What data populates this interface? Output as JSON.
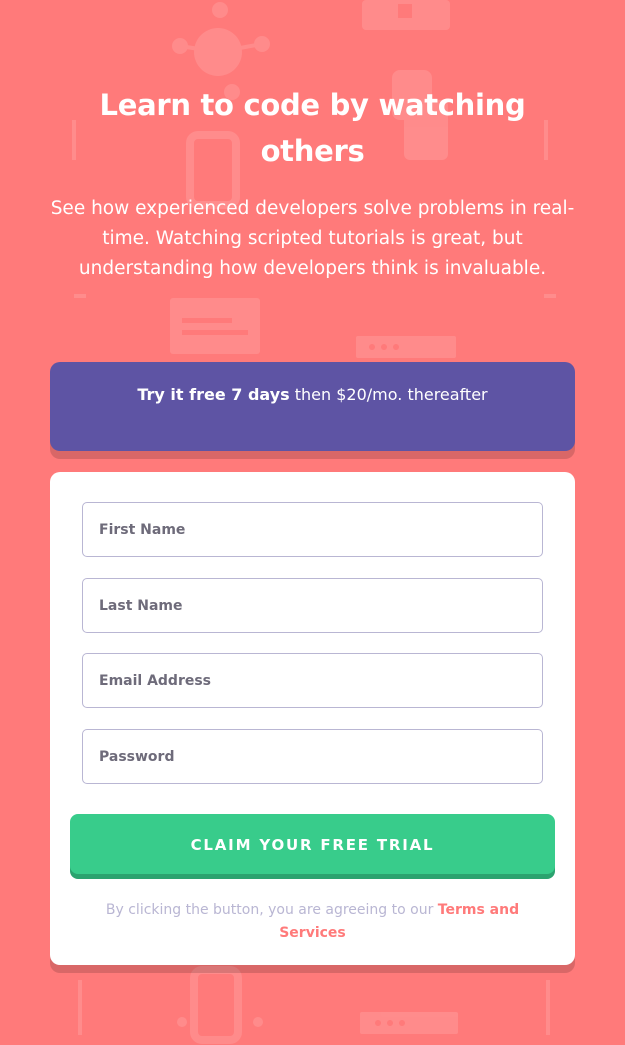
{
  "hero": {
    "headline": "Learn to code by watching others",
    "description": "See how experienced developers solve problems in real-time. Watching scripted tutorials is great, but understanding how developers think is invaluable."
  },
  "promo": {
    "bold": "Try it free 7 days",
    "rest": " then $20/mo. thereafter"
  },
  "form": {
    "first_name": {
      "placeholder": "First Name",
      "value": ""
    },
    "last_name": {
      "placeholder": "Last Name",
      "value": ""
    },
    "email": {
      "placeholder": "Email Address",
      "value": ""
    },
    "password": {
      "placeholder": "Password",
      "value": ""
    },
    "submit_label": "CLAIM YOUR FREE TRIAL",
    "terms_prefix": "By clicking the button, you are agreeing to our ",
    "terms_link": "Terms and Services"
  },
  "colors": {
    "background": "#ff7a7a",
    "promo": "#5e54a4",
    "button": "#38cc8b",
    "field_border": "#b9b6d3",
    "terms_text": "#b9b6d3",
    "terms_link": "#ff7a7a"
  }
}
